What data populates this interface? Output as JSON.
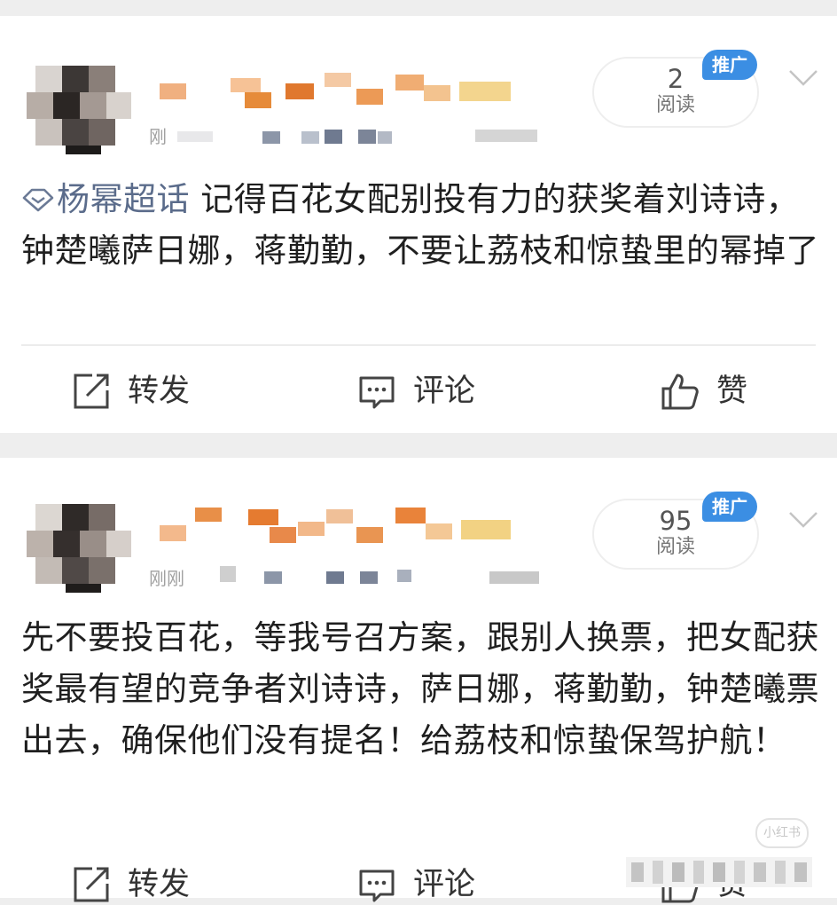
{
  "posts": [
    {
      "timestamp": "刚",
      "read_count": "2",
      "read_label": "阅读",
      "promo_badge": "推广",
      "topic": "杨幂超话",
      "content": " 记得百花女配别投有力的获奖着刘诗诗，钟楚曦萨日娜，蒋勤勤，不要让荔枝和惊蛰里的幂掉了",
      "actions": {
        "repost": "转发",
        "comment": "评论",
        "like": "赞"
      }
    },
    {
      "timestamp": "刚刚",
      "read_count": "95",
      "read_label": "阅读",
      "promo_badge": "推广",
      "content": "先不要投百花，等我号召方案，跟别人换票，把女配获奖最有望的竞争者刘诗诗，萨日娜，蒋勤勤，钟楚曦票出去，确保他们没有提名！给荔枝和惊蛰保驾护航！",
      "actions": {
        "repost": "转发",
        "comment": "评论",
        "like": "赞"
      }
    }
  ],
  "watermark": "小红书",
  "colors": {
    "promo_blue": "#3b8ee3",
    "topic_gray": "#5b6c8b",
    "page_bg": "#eeeeee"
  },
  "icons": [
    "topic-diamond-icon",
    "repost-icon",
    "comment-icon",
    "like-icon",
    "chevron-down-icon"
  ]
}
